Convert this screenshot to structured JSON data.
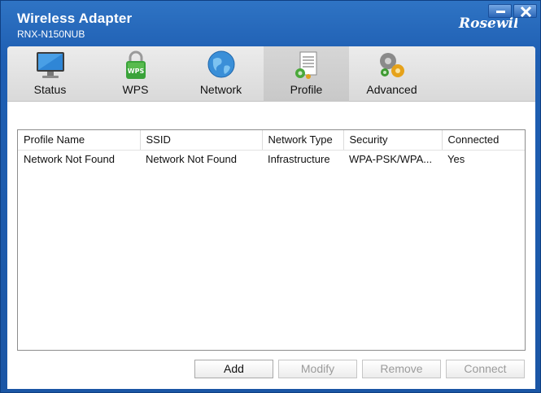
{
  "window": {
    "title": "Wireless Adapter",
    "model": "RNX-N150NUB",
    "brand": "Rosewill"
  },
  "toolbar": {
    "items": [
      {
        "label": "Status",
        "icon": "monitor-icon"
      },
      {
        "label": "WPS",
        "icon": "wps-lock-icon"
      },
      {
        "label": "Network",
        "icon": "globe-icon"
      },
      {
        "label": "Profile",
        "icon": "document-gear-icon"
      },
      {
        "label": "Advanced",
        "icon": "gears-icon"
      }
    ],
    "active": "Profile"
  },
  "profile_table": {
    "columns": [
      "Profile Name",
      "SSID",
      "Network Type",
      "Security",
      "Connected"
    ],
    "rows": [
      [
        "Network Not Found",
        "Network Not Found",
        "Infrastructure",
        "WPA-PSK/WPA...",
        "Yes"
      ]
    ]
  },
  "buttons": {
    "add": "Add",
    "modify": "Modify",
    "remove": "Remove",
    "connect": "Connect"
  },
  "colors": {
    "frame": "#1f5fb3",
    "toolbar": "#e3e3e3",
    "active_tab": "#cfcfcf",
    "disabled_text": "#9b9b9b"
  }
}
